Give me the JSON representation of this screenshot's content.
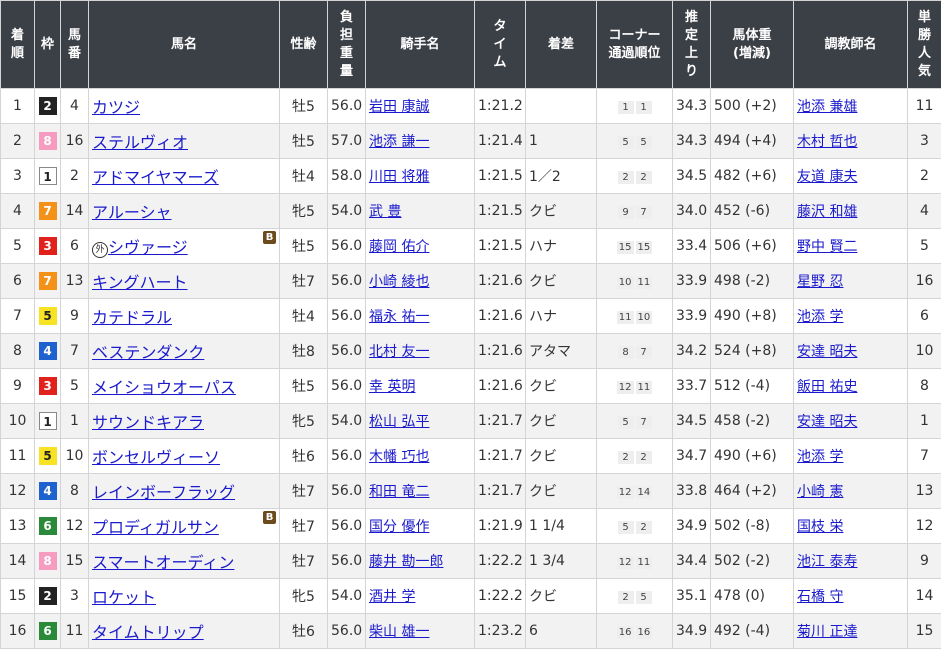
{
  "headers": [
    {
      "key": "finish",
      "label": "着順",
      "vertical": true
    },
    {
      "key": "frame",
      "label": "枠",
      "vertical": true
    },
    {
      "key": "number",
      "label": "馬番",
      "vertical": true
    },
    {
      "key": "horse",
      "label": "馬名",
      "vertical": false
    },
    {
      "key": "sex_age",
      "label": "性齢",
      "vertical": false
    },
    {
      "key": "weight",
      "label": "負担重量",
      "vertical": true
    },
    {
      "key": "jockey",
      "label": "騎手名",
      "vertical": false
    },
    {
      "key": "time",
      "label": "タイム",
      "vertical": true
    },
    {
      "key": "margin",
      "label": "着差",
      "vertical": false
    },
    {
      "key": "corner",
      "label": "コーナー通過順位",
      "vertical": false,
      "lines": [
        "コーナー",
        "通過順位"
      ]
    },
    {
      "key": "last3f",
      "label": "推定上り",
      "vertical": true
    },
    {
      "key": "body",
      "label": "馬体重(増減)",
      "vertical": false,
      "lines": [
        "馬体重",
        "(増減)"
      ]
    },
    {
      "key": "trainer",
      "label": "調教師名",
      "vertical": false
    },
    {
      "key": "pop",
      "label": "単勝人気",
      "vertical": true
    }
  ],
  "frame_colors": {
    "1": "#ffffff",
    "2": "#222222",
    "3": "#e0211c",
    "4": "#1e62d0",
    "5": "#f7e224",
    "6": "#2a8a3a",
    "7": "#f39118",
    "8": "#f59cc0"
  },
  "rows": [
    {
      "finish": "1",
      "frame": "2",
      "number": "4",
      "prefix": "",
      "horse": "カツジ",
      "blinker": "",
      "sex_age": "牡5",
      "weight": "56.0",
      "jockey": "岩田 康誠",
      "time": "1:21.2",
      "margin": "",
      "corner": [
        "1",
        "1"
      ],
      "last3f": "34.3",
      "body": "500 (+2)",
      "trainer": "池添 兼雄",
      "pop": "11"
    },
    {
      "finish": "2",
      "frame": "8",
      "number": "16",
      "prefix": "",
      "horse": "ステルヴィオ",
      "blinker": "",
      "sex_age": "牡5",
      "weight": "57.0",
      "jockey": "池添 謙一",
      "time": "1:21.4",
      "margin": "1",
      "corner": [
        "5",
        "5"
      ],
      "last3f": "34.3",
      "body": "494 (+4)",
      "trainer": "木村 哲也",
      "pop": "3"
    },
    {
      "finish": "3",
      "frame": "1",
      "number": "2",
      "prefix": "",
      "horse": "アドマイヤマーズ",
      "blinker": "",
      "sex_age": "牡4",
      "weight": "58.0",
      "jockey": "川田 将雅",
      "time": "1:21.5",
      "margin": "1／2",
      "corner": [
        "2",
        "2"
      ],
      "last3f": "34.5",
      "body": "482 (+6)",
      "trainer": "友道 康夫",
      "pop": "2"
    },
    {
      "finish": "4",
      "frame": "7",
      "number": "14",
      "prefix": "",
      "horse": "アルーシャ",
      "blinker": "",
      "sex_age": "牝5",
      "weight": "54.0",
      "jockey": "武 豊",
      "time": "1:21.5",
      "margin": "クビ",
      "corner": [
        "9",
        "7"
      ],
      "last3f": "34.0",
      "body": "452 (-6)",
      "trainer": "藤沢 和雄",
      "pop": "4"
    },
    {
      "finish": "5",
      "frame": "3",
      "number": "6",
      "prefix": "外",
      "horse": "シヴァージ",
      "blinker": "B",
      "sex_age": "牡5",
      "weight": "56.0",
      "jockey": "藤岡 佑介",
      "time": "1:21.5",
      "margin": "ハナ",
      "corner": [
        "15",
        "15"
      ],
      "last3f": "33.4",
      "body": "506 (+6)",
      "trainer": "野中 賢二",
      "pop": "5"
    },
    {
      "finish": "6",
      "frame": "7",
      "number": "13",
      "prefix": "",
      "horse": "キングハート",
      "blinker": "",
      "sex_age": "牡7",
      "weight": "56.0",
      "jockey": "小崎 綾也",
      "time": "1:21.6",
      "margin": "クビ",
      "corner": [
        "10",
        "11"
      ],
      "last3f": "33.9",
      "body": "498 (-2)",
      "trainer": "星野 忍",
      "pop": "16"
    },
    {
      "finish": "7",
      "frame": "5",
      "number": "9",
      "prefix": "",
      "horse": "カテドラル",
      "blinker": "",
      "sex_age": "牡4",
      "weight": "56.0",
      "jockey": "福永 祐一",
      "time": "1:21.6",
      "margin": "ハナ",
      "corner": [
        "11",
        "10"
      ],
      "last3f": "33.9",
      "body": "490 (+8)",
      "trainer": "池添 学",
      "pop": "6"
    },
    {
      "finish": "8",
      "frame": "4",
      "number": "7",
      "prefix": "",
      "horse": "ベステンダンク",
      "blinker": "",
      "sex_age": "牡8",
      "weight": "56.0",
      "jockey": "北村 友一",
      "time": "1:21.6",
      "margin": "アタマ",
      "corner": [
        "8",
        "7"
      ],
      "last3f": "34.2",
      "body": "524 (+8)",
      "trainer": "安達 昭夫",
      "pop": "10"
    },
    {
      "finish": "9",
      "frame": "3",
      "number": "5",
      "prefix": "",
      "horse": "メイショウオーパス",
      "blinker": "",
      "sex_age": "牡5",
      "weight": "56.0",
      "jockey": "幸 英明",
      "time": "1:21.6",
      "margin": "クビ",
      "corner": [
        "12",
        "11"
      ],
      "last3f": "33.7",
      "body": "512 (-4)",
      "trainer": "飯田 祐史",
      "pop": "8"
    },
    {
      "finish": "10",
      "frame": "1",
      "number": "1",
      "prefix": "",
      "horse": "サウンドキアラ",
      "blinker": "",
      "sex_age": "牝5",
      "weight": "54.0",
      "jockey": "松山 弘平",
      "time": "1:21.7",
      "margin": "クビ",
      "corner": [
        "5",
        "7"
      ],
      "last3f": "34.5",
      "body": "458 (-2)",
      "trainer": "安達 昭夫",
      "pop": "1"
    },
    {
      "finish": "11",
      "frame": "5",
      "number": "10",
      "prefix": "",
      "horse": "ボンセルヴィーソ",
      "blinker": "",
      "sex_age": "牡6",
      "weight": "56.0",
      "jockey": "木幡 巧也",
      "time": "1:21.7",
      "margin": "クビ",
      "corner": [
        "2",
        "2"
      ],
      "last3f": "34.7",
      "body": "490 (+6)",
      "trainer": "池添 学",
      "pop": "7"
    },
    {
      "finish": "12",
      "frame": "4",
      "number": "8",
      "prefix": "",
      "horse": "レインボーフラッグ",
      "blinker": "",
      "sex_age": "牡7",
      "weight": "56.0",
      "jockey": "和田 竜二",
      "time": "1:21.7",
      "margin": "クビ",
      "corner": [
        "12",
        "14"
      ],
      "last3f": "33.8",
      "body": "464 (+2)",
      "trainer": "小崎 憲",
      "pop": "13"
    },
    {
      "finish": "13",
      "frame": "6",
      "number": "12",
      "prefix": "",
      "horse": "プロディガルサン",
      "blinker": "B",
      "sex_age": "牡7",
      "weight": "56.0",
      "jockey": "国分 優作",
      "time": "1:21.9",
      "margin": "1 1/4",
      "corner": [
        "5",
        "2"
      ],
      "last3f": "34.9",
      "body": "502 (-8)",
      "trainer": "国枝 栄",
      "pop": "12"
    },
    {
      "finish": "14",
      "frame": "8",
      "number": "15",
      "prefix": "",
      "horse": "スマートオーディン",
      "blinker": "",
      "sex_age": "牡7",
      "weight": "56.0",
      "jockey": "藤井 勘一郎",
      "time": "1:22.2",
      "margin": "1 3/4",
      "corner": [
        "12",
        "11"
      ],
      "last3f": "34.4",
      "body": "502 (-2)",
      "trainer": "池江 泰寿",
      "pop": "9"
    },
    {
      "finish": "15",
      "frame": "2",
      "number": "3",
      "prefix": "",
      "horse": "ロケット",
      "blinker": "",
      "sex_age": "牝5",
      "weight": "54.0",
      "jockey": "酒井 学",
      "time": "1:22.2",
      "margin": "クビ",
      "corner": [
        "2",
        "5"
      ],
      "last3f": "35.1",
      "body": "478 (0)",
      "trainer": "石橋 守",
      "pop": "14"
    },
    {
      "finish": "16",
      "frame": "6",
      "number": "11",
      "prefix": "",
      "horse": "タイムトリップ",
      "blinker": "",
      "sex_age": "牡6",
      "weight": "56.0",
      "jockey": "柴山 雄一",
      "time": "1:23.2",
      "margin": "6",
      "corner": [
        "16",
        "16"
      ],
      "last3f": "34.9",
      "body": "492 (-4)",
      "trainer": "菊川 正達",
      "pop": "15"
    }
  ]
}
